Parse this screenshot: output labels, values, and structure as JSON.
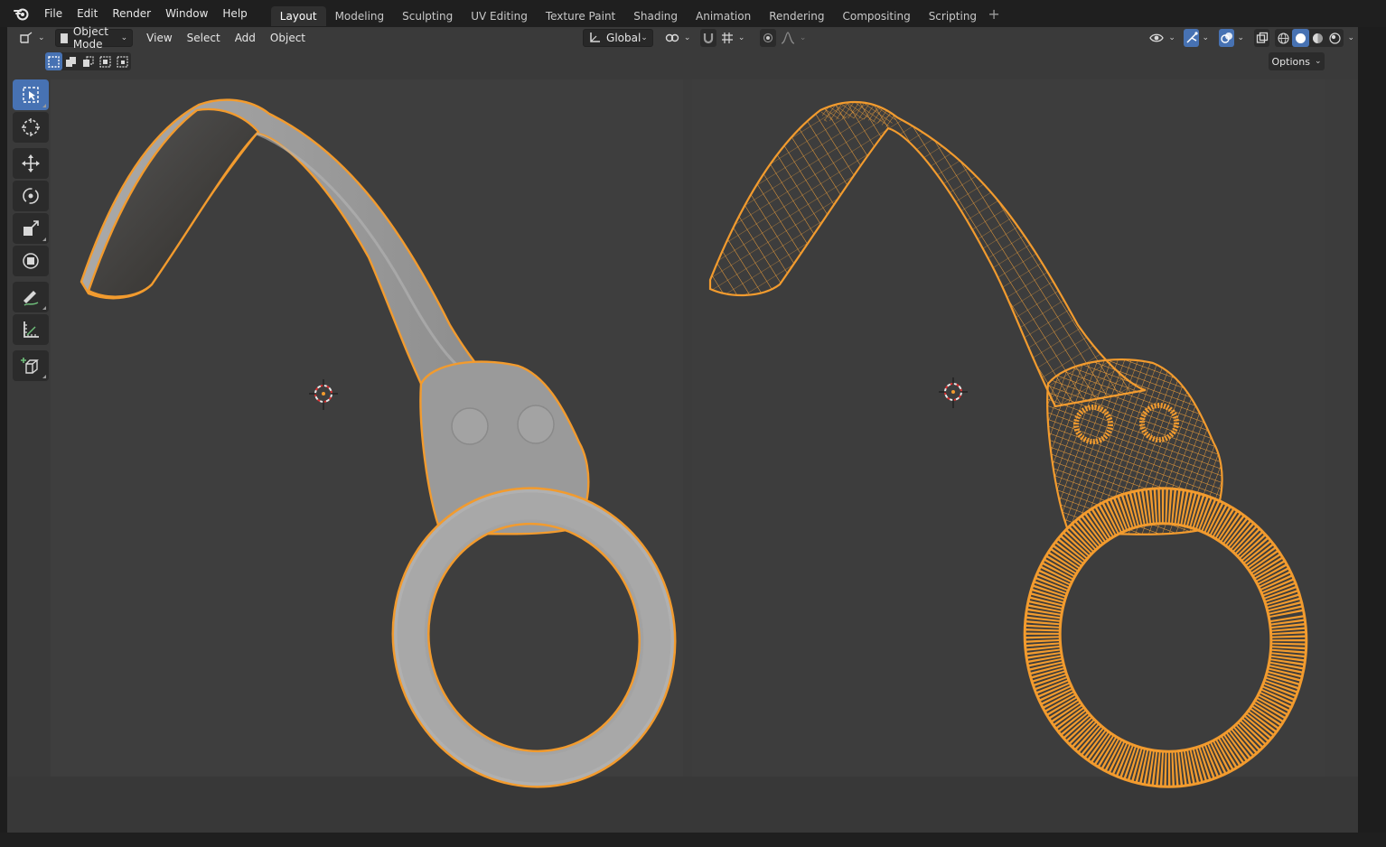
{
  "menu": {
    "logo": "blender-logo-icon",
    "items": [
      "File",
      "Edit",
      "Render",
      "Window",
      "Help"
    ]
  },
  "workspaces": {
    "tabs": [
      "Layout",
      "Modeling",
      "Sculpting",
      "UV Editing",
      "Texture Paint",
      "Shading",
      "Animation",
      "Rendering",
      "Compositing",
      "Scripting"
    ],
    "active": "Layout",
    "add_label": "+"
  },
  "viewport_header": {
    "mode_label": "Object Mode",
    "menus": [
      "View",
      "Select",
      "Add",
      "Object"
    ],
    "orientation_label": "Global",
    "options_label": "Options"
  },
  "toolbar": {
    "tools": [
      "select-box-icon",
      "cursor-icon",
      "move-icon",
      "rotate-icon",
      "scale-icon",
      "transform-icon",
      "annotate-icon",
      "measure-icon",
      "add-cube-icon"
    ],
    "active": "select-box-icon"
  },
  "colors": {
    "selection_outline": "#f29b2e",
    "wire": "#f2a13a",
    "active_button": "#4772b3",
    "viewport_bg": "#3a3a3a"
  }
}
